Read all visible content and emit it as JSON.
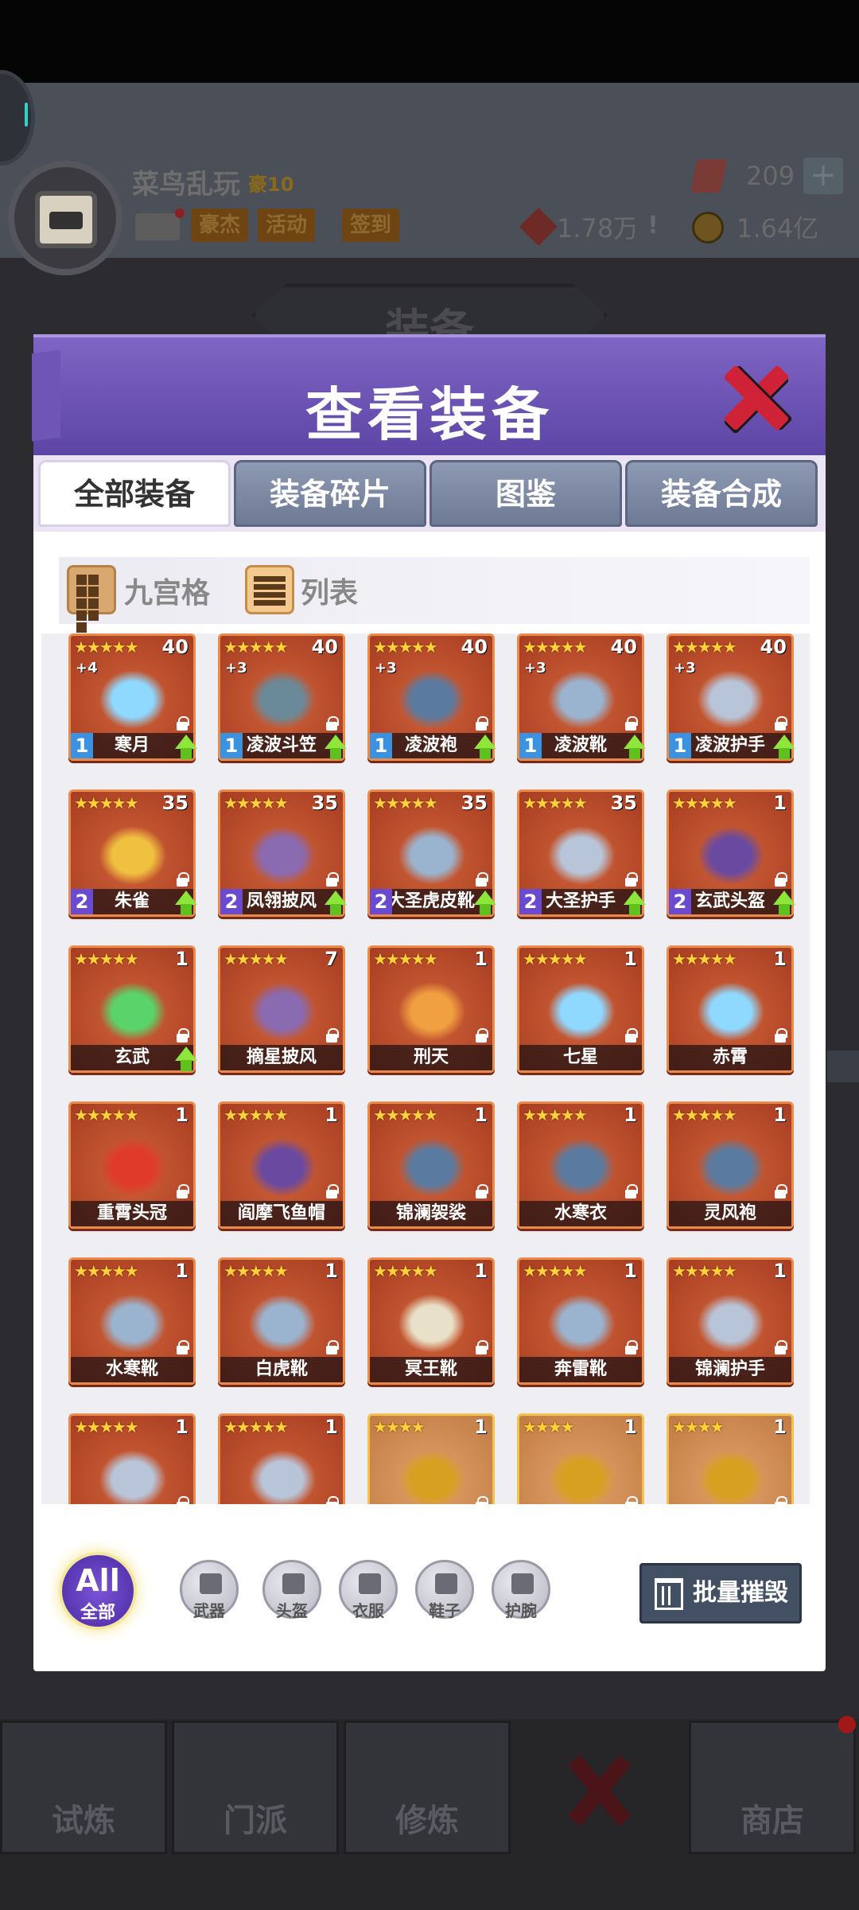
{
  "top": {
    "player_name": "菜鸟乱玩",
    "rank": "豪10",
    "buttons": [
      "豪杰",
      "活动",
      "签到"
    ],
    "gems": "209",
    "tokens": "1.78万",
    "gold": "1.64亿",
    "plus": "+",
    "alert": "!",
    "plaque": "装备"
  },
  "dialog": {
    "title": "查看装备",
    "tabs": [
      "全部装备",
      "装备碎片",
      "图鉴",
      "装备合成"
    ],
    "views": [
      "九宫格",
      "列表"
    ]
  },
  "items": [
    {
      "name": "寒月",
      "stars": "★★★★★",
      "level": "40",
      "plus": "+4",
      "tier": "1",
      "upgrade": true,
      "art": "sword-icon"
    },
    {
      "name": "凌波斗笠",
      "stars": "★★★★★",
      "level": "40",
      "plus": "+3",
      "tier": "1",
      "upgrade": true,
      "art": "hat-icon"
    },
    {
      "name": "凌波袍",
      "stars": "★★★★★",
      "level": "40",
      "plus": "+3",
      "tier": "1",
      "upgrade": true,
      "art": "robe-icon"
    },
    {
      "name": "凌波靴",
      "stars": "★★★★★",
      "level": "40",
      "plus": "+3",
      "tier": "1",
      "upgrade": true,
      "art": "boot-icon"
    },
    {
      "name": "凌波护手",
      "stars": "★★★★★",
      "level": "40",
      "plus": "+3",
      "tier": "1",
      "upgrade": true,
      "art": "gauntlet-icon"
    },
    {
      "name": "朱雀",
      "stars": "★★★★★",
      "level": "35",
      "plus": "",
      "tier": "2",
      "upgrade": true,
      "art": "spear-icon"
    },
    {
      "name": "凤翎披风",
      "stars": "★★★★★",
      "level": "35",
      "plus": "",
      "tier": "2",
      "upgrade": true,
      "art": "cloak-icon"
    },
    {
      "name": "大圣虎皮靴",
      "stars": "★★★★★",
      "level": "35",
      "plus": "",
      "tier": "2",
      "upgrade": true,
      "art": "boot-icon"
    },
    {
      "name": "大圣护手",
      "stars": "★★★★★",
      "level": "35",
      "plus": "",
      "tier": "2",
      "upgrade": true,
      "art": "gauntlet-icon"
    },
    {
      "name": "玄武头盔",
      "stars": "★★★★★",
      "level": "1",
      "plus": "",
      "tier": "2",
      "upgrade": true,
      "art": "helmet-icon"
    },
    {
      "name": "玄武",
      "stars": "★★★★★",
      "level": "1",
      "plus": "",
      "tier": "",
      "upgrade": true,
      "art": "turtle-icon"
    },
    {
      "name": "摘星披风",
      "stars": "★★★★★",
      "level": "7",
      "plus": "",
      "tier": "",
      "upgrade": false,
      "art": "cloak-icon"
    },
    {
      "name": "刑天",
      "stars": "★★★★★",
      "level": "1",
      "plus": "",
      "tier": "",
      "upgrade": false,
      "art": "axe-icon"
    },
    {
      "name": "七星",
      "stars": "★★★★★",
      "level": "1",
      "plus": "",
      "tier": "",
      "upgrade": false,
      "art": "sword-icon"
    },
    {
      "name": "赤霄",
      "stars": "★★★★★",
      "level": "1",
      "plus": "",
      "tier": "",
      "upgrade": false,
      "art": "sword-icon"
    },
    {
      "name": "重霄头冠",
      "stars": "★★★★★",
      "level": "1",
      "plus": "",
      "tier": "",
      "upgrade": false,
      "art": "crown-icon"
    },
    {
      "name": "阎摩飞鱼帽",
      "stars": "★★★★★",
      "level": "1",
      "plus": "",
      "tier": "",
      "upgrade": false,
      "art": "helmet-icon"
    },
    {
      "name": "锦澜袈裟",
      "stars": "★★★★★",
      "level": "1",
      "plus": "",
      "tier": "",
      "upgrade": false,
      "art": "robe-icon"
    },
    {
      "name": "水寒衣",
      "stars": "★★★★★",
      "level": "1",
      "plus": "",
      "tier": "",
      "upgrade": false,
      "art": "robe-icon"
    },
    {
      "name": "灵风袍",
      "stars": "★★★★★",
      "level": "1",
      "plus": "",
      "tier": "",
      "upgrade": false,
      "art": "robe-icon"
    },
    {
      "name": "水寒靴",
      "stars": "★★★★★",
      "level": "1",
      "plus": "",
      "tier": "",
      "upgrade": false,
      "art": "boot-icon"
    },
    {
      "name": "白虎靴",
      "stars": "★★★★★",
      "level": "1",
      "plus": "",
      "tier": "",
      "upgrade": false,
      "art": "boot-icon"
    },
    {
      "name": "冥王靴",
      "stars": "★★★★★",
      "level": "1",
      "plus": "",
      "tier": "",
      "upgrade": false,
      "art": "shoe-icon"
    },
    {
      "name": "奔雷靴",
      "stars": "★★★★★",
      "level": "1",
      "plus": "",
      "tier": "",
      "upgrade": false,
      "art": "boot-icon"
    },
    {
      "name": "锦澜护手",
      "stars": "★★★★★",
      "level": "1",
      "plus": "",
      "tier": "",
      "upgrade": false,
      "art": "gauntlet-icon"
    },
    {
      "name": "",
      "stars": "★★★★★",
      "level": "1",
      "plus": "",
      "tier": "",
      "upgrade": false,
      "art": "gauntlet-icon"
    },
    {
      "name": "",
      "stars": "★★★★★",
      "level": "1",
      "plus": "",
      "tier": "",
      "upgrade": false,
      "art": "gauntlet-icon"
    },
    {
      "name": "",
      "stars": "★★★★",
      "level": "1",
      "plus": "",
      "tier": "",
      "upgrade": false,
      "art": "staff-icon",
      "gold": true
    },
    {
      "name": "",
      "stars": "★★★★",
      "level": "1",
      "plus": "",
      "tier": "",
      "upgrade": false,
      "art": "staff-icon",
      "gold": true
    },
    {
      "name": "",
      "stars": "★★★★",
      "level": "1",
      "plus": "",
      "tier": "",
      "upgrade": false,
      "art": "staff-icon",
      "gold": true
    }
  ],
  "filters": {
    "all_top": "All",
    "all_bottom": "全部",
    "types": [
      "武器",
      "头盔",
      "衣服",
      "鞋子",
      "护腕"
    ],
    "batch_destroy": "批量摧毁"
  },
  "nav": [
    "试炼",
    "门派",
    "修炼",
    "",
    "商店"
  ],
  "colors": {
    "header_purple": "#6a52b4",
    "item_orange": "#b8472a",
    "tier1_blue": "#3a92e0",
    "tier2_purple": "#6a4ad0",
    "upgrade_green": "#7bd52e",
    "close_red": "#d02236"
  }
}
